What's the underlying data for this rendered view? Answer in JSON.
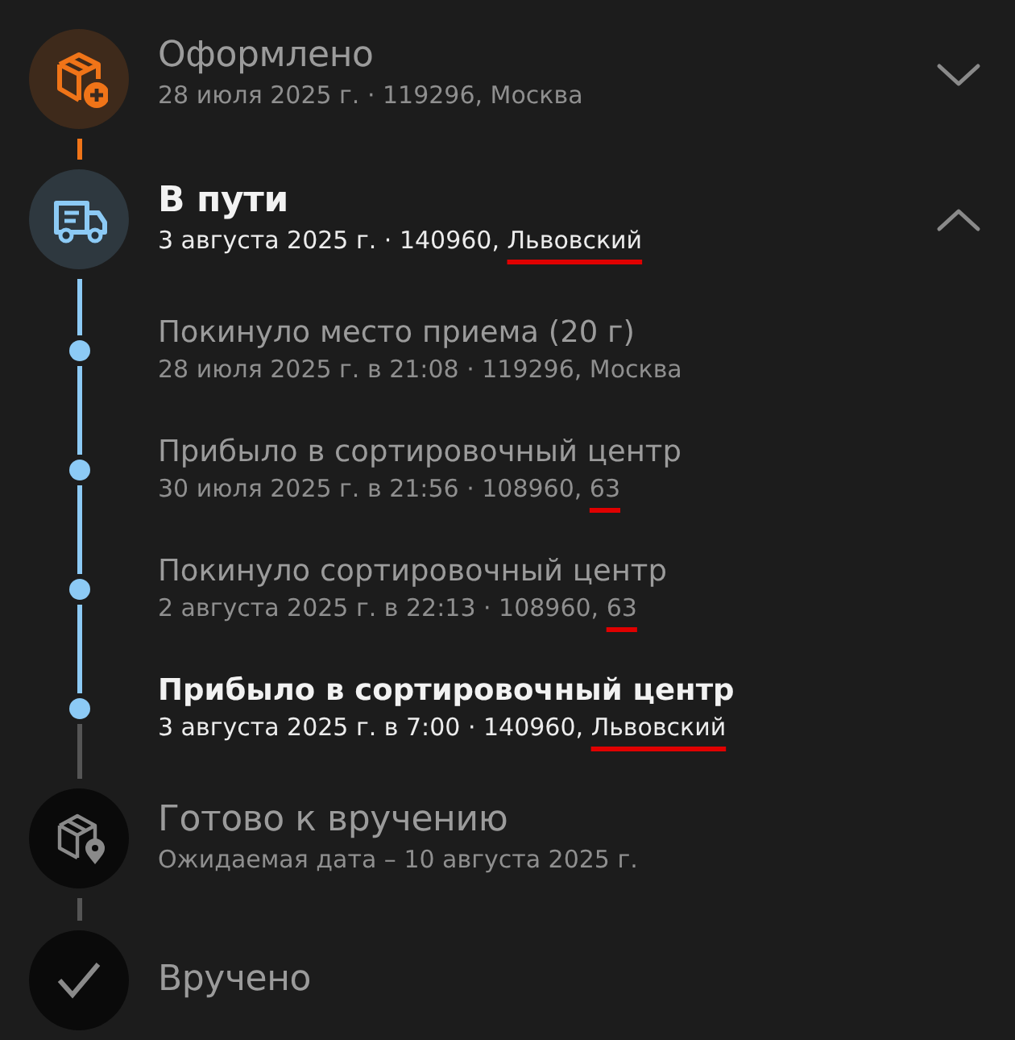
{
  "stages": [
    {
      "title": "Оформлено",
      "details": "28 июля 2025 г. · 119296, Москва",
      "color": "#f07418",
      "reached": true,
      "current": false,
      "expanded": false
    },
    {
      "title": "В пути",
      "details": "3 августа 2025 г. · 140960,",
      "underlined": "Львовский",
      "color": "#8ccaf5",
      "reached": true,
      "current": true,
      "expanded": true,
      "events": [
        {
          "title": "Покинуло место приема (20 г)",
          "details": "28 июля 2025 г. в 21:08 · 119296, Москва",
          "highlighted": false
        },
        {
          "title": "Прибыло в сортировочный центр",
          "details": "30 июля 2025 г. в 21:56 · 108960,",
          "underlined": "63",
          "highlighted": false
        },
        {
          "title": "Покинуло сортировочный центр",
          "details": "2 августа 2025 г. в 22:13 · 108960,",
          "underlined": "63",
          "highlighted": false
        },
        {
          "title": "Прибыло в сортировочный центр",
          "details": "3 августа 2025 г. в 7:00 · 140960,",
          "underlined": "Львовский",
          "highlighted": true
        }
      ]
    },
    {
      "title": "Готово к вручению",
      "details": "Ожидаемая дата – 10 августа 2025 г.",
      "color": "#8a8a8a",
      "reached": false,
      "current": false
    },
    {
      "title": "Вручено",
      "color": "#8a8a8a",
      "reached": false,
      "current": false
    }
  ]
}
